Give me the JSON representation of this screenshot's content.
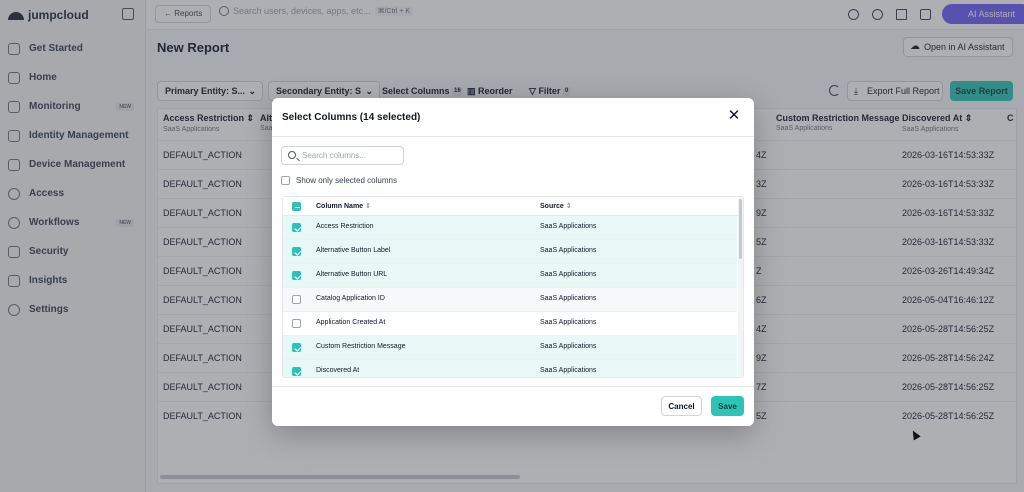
{
  "sidebar": {
    "logo_text": "jumpcloud",
    "items": [
      {
        "label": "Get Started",
        "badge": ""
      },
      {
        "label": "Home",
        "badge": ""
      },
      {
        "label": "Monitoring",
        "badge": "NEW"
      },
      {
        "label": "Identity Management",
        "badge": ""
      },
      {
        "label": "Device Management",
        "badge": ""
      },
      {
        "label": "Access",
        "badge": ""
      },
      {
        "label": "Workflows",
        "badge": "NEW"
      },
      {
        "label": "Security",
        "badge": ""
      },
      {
        "label": "Insights",
        "badge": ""
      },
      {
        "label": "Settings",
        "badge": ""
      }
    ]
  },
  "topbar": {
    "back_label": "← Reports",
    "search_placeholder": "Search users, devices, apps, etc...",
    "shortcut": "⌘/Ctrl + K",
    "ai_label": "AI Assistant"
  },
  "page": {
    "title": "New Report",
    "open_ai_label": "Open in AI Assistant"
  },
  "toolbar": {
    "primary_entity": "Primary Entity: S...",
    "secondary_entity": "Secondary Entity: S",
    "select_columns": "Select Columns",
    "select_columns_count": "16",
    "reorder": "Reorder",
    "filter": "Filter",
    "filter_count": "0",
    "export": "Export Full Report",
    "save": "Save Report"
  },
  "table": {
    "columns": [
      {
        "header": "Access Restriction ⇕",
        "sub": "SaaS Applications"
      },
      {
        "header": "Alt",
        "sub": "Saa"
      },
      {
        "header": "Custom Restriction Message",
        "sub": "SaaS Applications"
      },
      {
        "header": "Discovered At ⇕",
        "sub": "SaaS Applications"
      },
      {
        "header": "C",
        "sub": ""
      }
    ],
    "rows": [
      {
        "access": "DEFAULT_ACTION",
        "partial": "4Z",
        "discovered": "2026-03-16T14:53:33Z"
      },
      {
        "access": "DEFAULT_ACTION",
        "partial": "3Z",
        "discovered": "2026-03-16T14:53:33Z"
      },
      {
        "access": "DEFAULT_ACTION",
        "partial": "9Z",
        "discovered": "2026-03-16T14:53:33Z"
      },
      {
        "access": "DEFAULT_ACTION",
        "partial": "5Z",
        "discovered": "2026-03-16T14:53:33Z"
      },
      {
        "access": "DEFAULT_ACTION",
        "partial": "Z",
        "discovered": "2026-03-26T14:49:34Z"
      },
      {
        "access": "DEFAULT_ACTION",
        "partial": "6Z",
        "discovered": "2026-05-04T16:46:12Z"
      },
      {
        "access": "DEFAULT_ACTION",
        "partial": "4Z",
        "discovered": "2026-05-28T14:56:25Z"
      },
      {
        "access": "DEFAULT_ACTION",
        "partial": "9Z",
        "discovered": "2026-05-28T14:56:24Z"
      },
      {
        "access": "DEFAULT_ACTION",
        "partial": "7Z",
        "discovered": "2026-05-28T14:56:25Z"
      },
      {
        "access": "DEFAULT_ACTION",
        "partial": "5Z",
        "discovered": "2026-05-28T14:56:25Z"
      }
    ]
  },
  "modal": {
    "title": "Select Columns (14 selected)",
    "close": "✕",
    "search_placeholder": "Search columns...",
    "show_only_selected": "Show only selected columns",
    "col_name_header": "Column Name",
    "source_header": "Source",
    "sort_glyph": "⇕",
    "rows": [
      {
        "name": "Access Restriction",
        "source": "SaaS Applications",
        "checked": true
      },
      {
        "name": "Alternative Button Label",
        "source": "SaaS Applications",
        "checked": true
      },
      {
        "name": "Alternative Button URL",
        "source": "SaaS Applications",
        "checked": true
      },
      {
        "name": "Catalog Application ID",
        "source": "SaaS Applications",
        "checked": false
      },
      {
        "name": "Application Created At",
        "source": "SaaS Applications",
        "checked": false
      },
      {
        "name": "Custom Restriction Message",
        "source": "SaaS Applications",
        "checked": true
      },
      {
        "name": "Discovered At",
        "source": "SaaS Applications",
        "checked": true
      }
    ],
    "cancel": "Cancel",
    "save": "Save"
  },
  "colors": {
    "accent": "#2cc4b8",
    "ai": "#6d5dfc",
    "selected_row": "#e7f8f6"
  }
}
